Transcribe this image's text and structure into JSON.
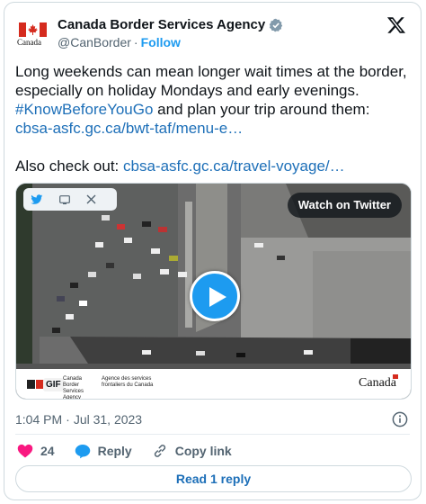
{
  "account": {
    "name": "Canada Border Services Agency",
    "handle": "@CanBorder",
    "follow_label": "Follow",
    "avatar_wordmark": "Canada"
  },
  "tweet": {
    "line1": "Long weekends can mean longer wait times at the border,",
    "line2": "especially on holiday Mondays and early evenings.",
    "hashtag": "#KnowBeforeYouGo",
    "line3_rest": " and plan your trip around them:",
    "link1": "cbsa-asfc.gc.ca/bwt-taf/menu-e…",
    "also_prefix": "Also check out: ",
    "link2": "cbsa-asfc.gc.ca/travel-voyage/…"
  },
  "media": {
    "watch_label": "Watch on Twitter",
    "gif_label": "GIF",
    "agency_en": "Canada Border Services Agency",
    "agency_fr": "Agence des services frontaliers du Canada",
    "wordmark": "Canada"
  },
  "meta": {
    "time": "1:04 PM",
    "date": "Jul 31, 2023"
  },
  "actions": {
    "like_count": "24",
    "reply_label": "Reply",
    "copy_label": "Copy link"
  },
  "read_reply_label": "Read 1 reply",
  "colors": {
    "brand_blue": "#1d9bf0",
    "link_blue": "#1d6fb8",
    "like_red": "#f91880",
    "flag_red": "#d52b1e"
  }
}
